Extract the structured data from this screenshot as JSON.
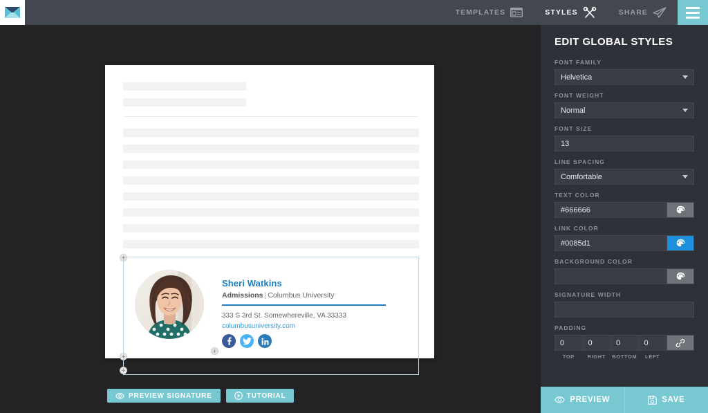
{
  "app": {
    "logo_icon": "envelope-icon"
  },
  "topbar": {
    "items": [
      {
        "label": "TEMPLATES",
        "icon": "templates-icon",
        "active": false
      },
      {
        "label": "STYLES",
        "icon": "styles-wands-icon",
        "active": true
      },
      {
        "label": "SHARE",
        "icon": "paper-plane-icon",
        "active": false
      }
    ],
    "menu_icon": "hamburger-menu-icon"
  },
  "document": {
    "placeholder_short_bars": 2,
    "placeholder_long_bars": 8
  },
  "signature": {
    "name": "Sheri Watkins",
    "role_bold": "Admissions",
    "role_separator": "|",
    "role_rest": "Columbus University",
    "address": "333 S 3rd St. Somewhereville, VA 33333",
    "website": "columbusuniversity.com",
    "avatar_alt": "portrait-photo",
    "socials": [
      {
        "name": "facebook-icon",
        "color": "#3b5a9b"
      },
      {
        "name": "twitter-icon",
        "color": "#4ab3f4"
      },
      {
        "name": "linkedin-icon",
        "color": "#2b7bb9"
      }
    ],
    "name_color": "#1a7fc1",
    "rule_color": "#1a7fc1",
    "border_color": "#bcdbe8"
  },
  "doc_actions": [
    {
      "label": "PREVIEW SIGNATURE",
      "icon": "eye-icon"
    },
    {
      "label": "TUTORIAL",
      "icon": "play-circle-icon"
    }
  ],
  "panel": {
    "title": "EDIT GLOBAL STYLES",
    "fields": {
      "font_family": {
        "label": "FONT FAMILY",
        "value": "Helvetica",
        "type": "select"
      },
      "font_weight": {
        "label": "FONT WEIGHT",
        "value": "Normal",
        "type": "select"
      },
      "font_size": {
        "label": "FONT SIZE",
        "value": "13",
        "type": "text"
      },
      "line_spacing": {
        "label": "LINE SPACING",
        "value": "Comfortable",
        "type": "select"
      },
      "text_color": {
        "label": "TEXT COLOR",
        "value": "#666666",
        "swatch_icon": "palette-icon"
      },
      "link_color": {
        "label": "LINK COLOR",
        "value": "#0085d1",
        "swatch_icon": "palette-icon",
        "swatch_color": "#1f8fdd"
      },
      "background_color": {
        "label": "BACKGROUND COLOR",
        "value": "",
        "swatch_icon": "palette-icon"
      },
      "signature_width": {
        "label": "SIGNATURE WIDTH",
        "value": ""
      },
      "padding": {
        "label": "PADDING",
        "link_icon": "link-chain-icon",
        "cells": [
          {
            "value": "0",
            "label": "TOP"
          },
          {
            "value": "0",
            "label": "RIGHT"
          },
          {
            "value": "0",
            "label": "BOTTOM"
          },
          {
            "value": "0",
            "label": "LEFT"
          }
        ]
      }
    },
    "footer": [
      {
        "label": "PREVIEW",
        "icon": "eye-icon"
      },
      {
        "label": "SAVE",
        "icon": "floppy-disk-icon"
      }
    ]
  },
  "colors": {
    "topbar": "#434750",
    "canvas": "#232326",
    "panel": "#2e3138",
    "accent_teal": "#78c8d2",
    "accent_blue": "#1f8fdd"
  }
}
